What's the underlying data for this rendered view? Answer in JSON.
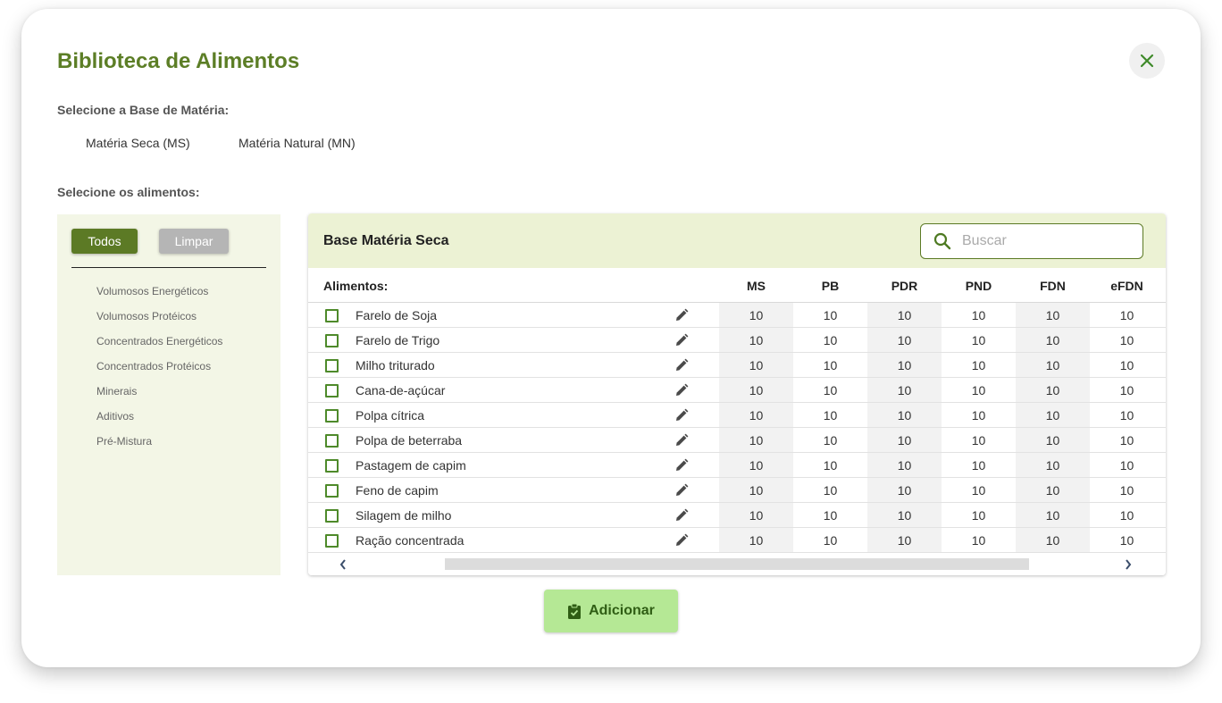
{
  "modal": {
    "title": "Biblioteca de Alimentos",
    "base_label": "Selecione a Base de Matéria:",
    "base_options": [
      "Matéria Seca (MS)",
      "Matéria Natural (MN)"
    ],
    "foods_label": "Selecione os alimentos:"
  },
  "filters": {
    "all_label": "Todos",
    "clear_label": "Limpar",
    "categories": [
      "Volumosos Energéticos",
      "Volumosos Protéicos",
      "Concentrados Energéticos",
      "Concentrados Protéicos",
      "Minerais",
      "Aditivos",
      "Pré-Mistura"
    ]
  },
  "table": {
    "title": "Base Matéria Seca",
    "search_placeholder": "Buscar",
    "name_header": "Alimentos:",
    "columns": [
      "MS",
      "PB",
      "PDR",
      "PND",
      "FDN",
      "eFDN"
    ],
    "rows": [
      {
        "name": "Farelo de Soja",
        "values": [
          "10",
          "10",
          "10",
          "10",
          "10",
          "10"
        ]
      },
      {
        "name": "Farelo de Trigo",
        "values": [
          "10",
          "10",
          "10",
          "10",
          "10",
          "10"
        ]
      },
      {
        "name": "Milho triturado",
        "values": [
          "10",
          "10",
          "10",
          "10",
          "10",
          "10"
        ]
      },
      {
        "name": "Cana-de-açúcar",
        "values": [
          "10",
          "10",
          "10",
          "10",
          "10",
          "10"
        ]
      },
      {
        "name": "Polpa cítrica",
        "values": [
          "10",
          "10",
          "10",
          "10",
          "10",
          "10"
        ]
      },
      {
        "name": "Polpa de beterraba",
        "values": [
          "10",
          "10",
          "10",
          "10",
          "10",
          "10"
        ]
      },
      {
        "name": "Pastagem de capim",
        "values": [
          "10",
          "10",
          "10",
          "10",
          "10",
          "10"
        ]
      },
      {
        "name": "Feno de capim",
        "values": [
          "10",
          "10",
          "10",
          "10",
          "10",
          "10"
        ]
      },
      {
        "name": "Silagem de milho",
        "values": [
          "10",
          "10",
          "10",
          "10",
          "10",
          "10"
        ]
      },
      {
        "name": "Ração concentrada",
        "values": [
          "10",
          "10",
          "10",
          "10",
          "10",
          "10"
        ]
      }
    ]
  },
  "footer": {
    "add_label": "Adicionar"
  },
  "colors": {
    "brand_green": "#5c7a25",
    "header_tint": "#ecf2d4",
    "panel_tint": "#f3f6e6",
    "add_button": "#b5e895"
  },
  "icons": {
    "close": "close-icon",
    "search": "search-icon",
    "edit": "pencil-icon",
    "add": "clipboard-check-icon",
    "scroll_left": "chevron-left-icon",
    "scroll_right": "chevron-right-icon"
  }
}
